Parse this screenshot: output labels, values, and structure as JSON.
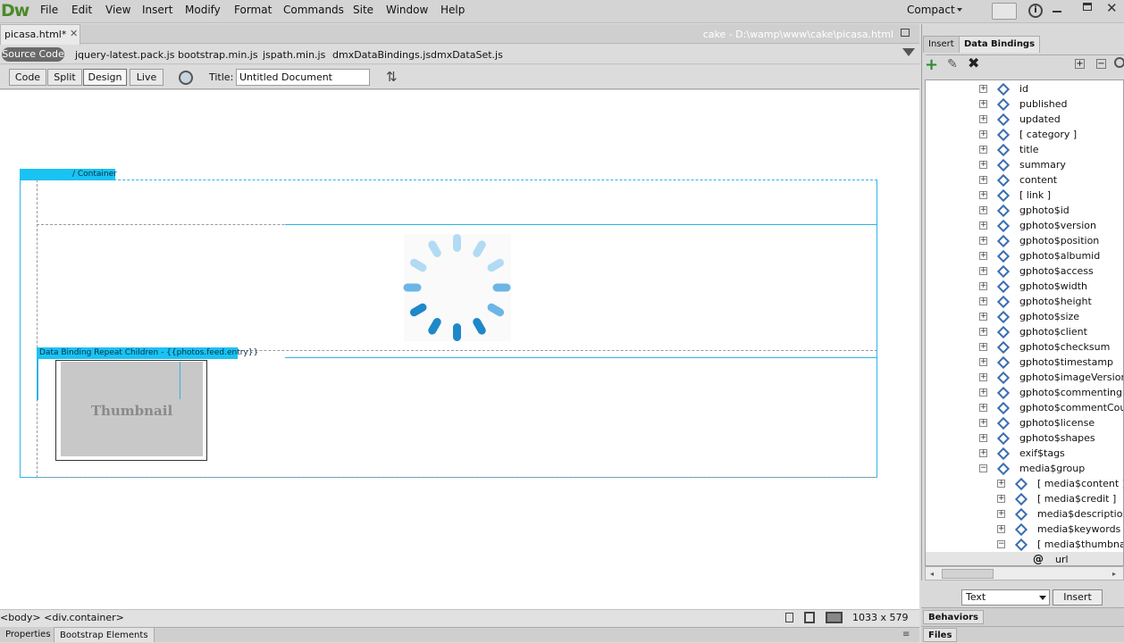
{
  "app": {
    "logo": "Dw",
    "menus": [
      "File",
      "Edit",
      "View",
      "Insert",
      "Modify",
      "Format",
      "Commands",
      "Site",
      "Window",
      "Help"
    ],
    "workspace": "Compact"
  },
  "document": {
    "tab": "picasa.html*",
    "path": "cake - D:\\wamp\\www\\cake\\picasa.html",
    "source_code": "Source Code",
    "related_files": [
      "jquery-latest.pack.js",
      "bootstrap.min.js",
      "jspath.min.js",
      "dmxDataBindings.js",
      "dmxDataSet.js"
    ]
  },
  "viewbar": {
    "code": "Code",
    "split": "Split",
    "design": "Design",
    "live": "Live",
    "title_label": "Title:",
    "title_value": "Untitled Document"
  },
  "design": {
    "container_label": "/ Container",
    "repeat_label": "Data Binding Repeat Children - {{photos.feed.entry}}",
    "thumbnail": "Thumbnail"
  },
  "status": {
    "tag_path": "<body> <div.container>",
    "size": "1033 x 579"
  },
  "bottom_tabs": {
    "properties": "Properties",
    "bootstrap": "Bootstrap Elements"
  },
  "panel": {
    "tabs": [
      "Insert",
      "Data Bindings"
    ],
    "tree": [
      {
        "label": "id",
        "level": 0,
        "array": false
      },
      {
        "label": "published",
        "level": 0,
        "array": false
      },
      {
        "label": "updated",
        "level": 0,
        "array": false
      },
      {
        "label": "[ category ]",
        "level": 0,
        "array": true
      },
      {
        "label": "title",
        "level": 0,
        "array": false
      },
      {
        "label": "summary",
        "level": 0,
        "array": false
      },
      {
        "label": "content",
        "level": 0,
        "array": false
      },
      {
        "label": "[ link ]",
        "level": 0,
        "array": true
      },
      {
        "label": "gphoto$id",
        "level": 0,
        "array": false
      },
      {
        "label": "gphoto$version",
        "level": 0,
        "array": false
      },
      {
        "label": "gphoto$position",
        "level": 0,
        "array": false
      },
      {
        "label": "gphoto$albumid",
        "level": 0,
        "array": false
      },
      {
        "label": "gphoto$access",
        "level": 0,
        "array": false
      },
      {
        "label": "gphoto$width",
        "level": 0,
        "array": false
      },
      {
        "label": "gphoto$height",
        "level": 0,
        "array": false
      },
      {
        "label": "gphoto$size",
        "level": 0,
        "array": false
      },
      {
        "label": "gphoto$client",
        "level": 0,
        "array": false
      },
      {
        "label": "gphoto$checksum",
        "level": 0,
        "array": false
      },
      {
        "label": "gphoto$timestamp",
        "level": 0,
        "array": false
      },
      {
        "label": "gphoto$imageVersion",
        "level": 0,
        "array": false
      },
      {
        "label": "gphoto$commentingEnab",
        "level": 0,
        "array": false
      },
      {
        "label": "gphoto$commentCount",
        "level": 0,
        "array": false
      },
      {
        "label": "gphoto$license",
        "level": 0,
        "array": false
      },
      {
        "label": "gphoto$shapes",
        "level": 0,
        "array": false
      },
      {
        "label": "exif$tags",
        "level": 0,
        "array": false
      },
      {
        "label": "media$group",
        "level": 0,
        "array": false,
        "expanded": true
      },
      {
        "label": "[ media$content ]",
        "level": 1,
        "array": true
      },
      {
        "label": "[ media$credit ]",
        "level": 1,
        "array": true
      },
      {
        "label": "media$description",
        "level": 1,
        "array": false
      },
      {
        "label": "media$keywords",
        "level": 1,
        "array": false
      },
      {
        "label": "[ media$thumbnail ]",
        "level": 1,
        "array": true,
        "expanded": true
      },
      {
        "label": "url",
        "level": 2,
        "attr": true
      }
    ],
    "format_select": "Text",
    "insert_button": "Insert",
    "behaviors": "Behaviors",
    "files": "Files"
  }
}
